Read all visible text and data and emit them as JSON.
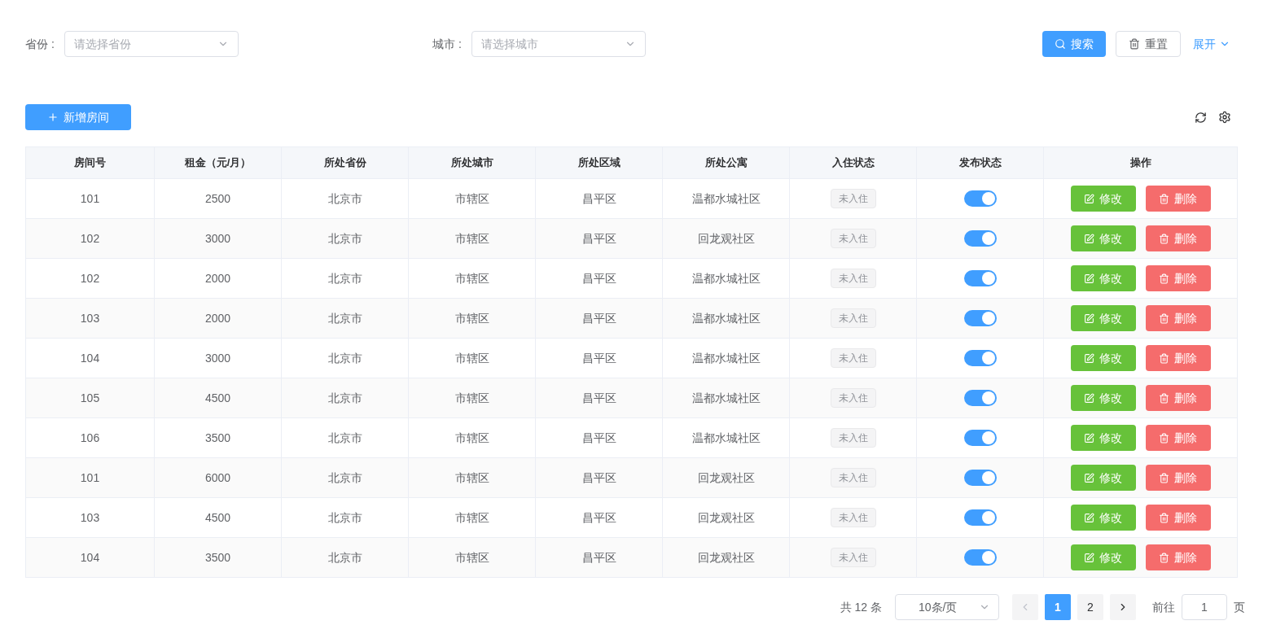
{
  "filters": [
    {
      "label": "省份 :",
      "placeholder": "请选择省份"
    },
    {
      "label": "城市 :",
      "placeholder": "请选择城市"
    }
  ],
  "search_button": "搜索",
  "reset_button": "重置",
  "expand_link": "展开",
  "add_button": "新增房间",
  "table": {
    "columns": [
      "房间号",
      "租金（元/月）",
      "所处省份",
      "所处城市",
      "所处区域",
      "所处公寓",
      "入住状态",
      "发布状态",
      "操作"
    ],
    "rows": [
      {
        "room": "101",
        "rent": "2500",
        "province": "北京市",
        "city": "市辖区",
        "district": "昌平区",
        "apartment": "温都水城社区",
        "status": "未入住",
        "published": true,
        "edit": "修改",
        "delete": "删除"
      },
      {
        "room": "102",
        "rent": "3000",
        "province": "北京市",
        "city": "市辖区",
        "district": "昌平区",
        "apartment": "回龙观社区",
        "status": "未入住",
        "published": true,
        "edit": "修改",
        "delete": "删除"
      },
      {
        "room": "102",
        "rent": "2000",
        "province": "北京市",
        "city": "市辖区",
        "district": "昌平区",
        "apartment": "温都水城社区",
        "status": "未入住",
        "published": true,
        "edit": "修改",
        "delete": "删除"
      },
      {
        "room": "103",
        "rent": "2000",
        "province": "北京市",
        "city": "市辖区",
        "district": "昌平区",
        "apartment": "温都水城社区",
        "status": "未入住",
        "published": true,
        "edit": "修改",
        "delete": "删除"
      },
      {
        "room": "104",
        "rent": "3000",
        "province": "北京市",
        "city": "市辖区",
        "district": "昌平区",
        "apartment": "温都水城社区",
        "status": "未入住",
        "published": true,
        "edit": "修改",
        "delete": "删除"
      },
      {
        "room": "105",
        "rent": "4500",
        "province": "北京市",
        "city": "市辖区",
        "district": "昌平区",
        "apartment": "温都水城社区",
        "status": "未入住",
        "published": true,
        "edit": "修改",
        "delete": "删除"
      },
      {
        "room": "106",
        "rent": "3500",
        "province": "北京市",
        "city": "市辖区",
        "district": "昌平区",
        "apartment": "温都水城社区",
        "status": "未入住",
        "published": true,
        "edit": "修改",
        "delete": "删除"
      },
      {
        "room": "101",
        "rent": "6000",
        "province": "北京市",
        "city": "市辖区",
        "district": "昌平区",
        "apartment": "回龙观社区",
        "status": "未入住",
        "published": true,
        "edit": "修改",
        "delete": "删除"
      },
      {
        "room": "103",
        "rent": "4500",
        "province": "北京市",
        "city": "市辖区",
        "district": "昌平区",
        "apartment": "回龙观社区",
        "status": "未入住",
        "published": true,
        "edit": "修改",
        "delete": "删除"
      },
      {
        "room": "104",
        "rent": "3500",
        "province": "北京市",
        "city": "市辖区",
        "district": "昌平区",
        "apartment": "回龙观社区",
        "status": "未入住",
        "published": true,
        "edit": "修改",
        "delete": "删除"
      }
    ]
  },
  "pagination": {
    "total": "共 12 条",
    "page_size": "10条/页",
    "pages": [
      {
        "label": "1",
        "selected": true
      },
      {
        "label": "2",
        "selected": false
      }
    ],
    "goto_label": "前往",
    "goto_value": "1",
    "page_suffix": "页"
  }
}
